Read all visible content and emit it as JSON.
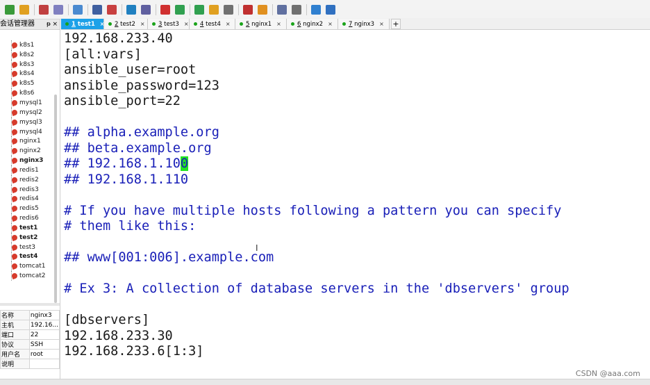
{
  "toolbar": {
    "icons": [
      "new-session-icon",
      "open-folder-icon",
      "connect-icon",
      "disconnect-icon",
      "layout-icon",
      "find-icon",
      "transfer-icon",
      "globe-icon",
      "font-icon",
      "xftp-icon",
      "terminal-icon",
      "fullscreen-icon",
      "lock-icon",
      "keyboard-icon",
      "pen-icon",
      "script-icon",
      "view-icon",
      "settings-icon",
      "help-icon",
      "chat-icon"
    ],
    "colors": [
      "#3a9a3a",
      "#e0a020",
      "#c04040",
      "#8080c0",
      "#4a8ad0",
      "#4060a0",
      "#c84040",
      "#2080c0",
      "#6060a0",
      "#d03030",
      "#30a050",
      "#30a050",
      "#e0a020",
      "#707070",
      "#c03030",
      "#e09020",
      "#6070a0",
      "#707070",
      "#3080d0",
      "#3070c0"
    ]
  },
  "sidebar": {
    "title": "会话管理器",
    "pin": "ᵽ",
    "close": "×",
    "sessions": [
      {
        "label": "k8s1"
      },
      {
        "label": "k8s2"
      },
      {
        "label": "k8s3"
      },
      {
        "label": "k8s4"
      },
      {
        "label": "k8s5"
      },
      {
        "label": "k8s6"
      },
      {
        "label": "mysql1"
      },
      {
        "label": "mysql2"
      },
      {
        "label": "mysql3"
      },
      {
        "label": "mysql4"
      },
      {
        "label": "nginx1"
      },
      {
        "label": "nginx2"
      },
      {
        "label": "nginx3",
        "bold": true
      },
      {
        "label": "redis1"
      },
      {
        "label": "redis2"
      },
      {
        "label": "redis3"
      },
      {
        "label": "redis4"
      },
      {
        "label": "redis5"
      },
      {
        "label": "redis6"
      },
      {
        "label": "test1",
        "bold": true
      },
      {
        "label": "test2",
        "bold": true
      },
      {
        "label": "test3"
      },
      {
        "label": "test4",
        "bold": true
      },
      {
        "label": "tomcat1"
      },
      {
        "label": "tomcat2"
      }
    ]
  },
  "properties": [
    {
      "key": "名称",
      "value": "nginx3"
    },
    {
      "key": "主机",
      "value": "192.16..."
    },
    {
      "key": "端口",
      "value": "22"
    },
    {
      "key": "协议",
      "value": "SSH"
    },
    {
      "key": "用户名",
      "value": "root"
    },
    {
      "key": "说明",
      "value": ""
    }
  ],
  "tabs": [
    {
      "num": "1",
      "name": " test1",
      "active": true
    },
    {
      "num": "2",
      "name": " test2",
      "active": false
    },
    {
      "num": "3",
      "name": " test3",
      "active": false
    },
    {
      "num": "4",
      "name": " test4",
      "active": false
    },
    {
      "num": "5",
      "name": " nginx1",
      "active": false
    },
    {
      "num": "6",
      "name": " nginx2",
      "active": false
    },
    {
      "num": "7",
      "name": " nginx3",
      "active": false
    }
  ],
  "tab_close": "×",
  "add_tab": "+",
  "terminal": {
    "lines": [
      {
        "text": "192.168.233.40",
        "comment": false
      },
      {
        "text": "[all:vars]",
        "comment": false
      },
      {
        "text": "ansible_user=root",
        "comment": false
      },
      {
        "text": "ansible_password=123",
        "comment": false
      },
      {
        "text": "ansible_port=22",
        "comment": false
      },
      {
        "text": "",
        "comment": false
      },
      {
        "text": "## alpha.example.org",
        "comment": true
      },
      {
        "text": "## beta.example.org",
        "comment": true
      },
      {
        "text": "## 192.168.1.10",
        "cursor": "0",
        "comment": true
      },
      {
        "text": "## 192.168.1.110",
        "comment": true
      },
      {
        "text": "",
        "comment": false
      },
      {
        "text": "# If you have multiple hosts following a pattern you can specify",
        "comment": true
      },
      {
        "text": "# them like this:",
        "comment": true
      },
      {
        "text": "",
        "comment": false
      },
      {
        "text": "## www[001:006].example.com",
        "comment": true
      },
      {
        "text": "",
        "comment": false
      },
      {
        "text": "# Ex 3: A collection of database servers in the 'dbservers' group",
        "comment": true
      },
      {
        "text": "",
        "comment": false
      },
      {
        "text": "[dbservers]",
        "comment": false
      },
      {
        "text": "192.168.233.30",
        "comment": false
      },
      {
        "text": "192.168.233.6[1:3]",
        "comment": false
      }
    ],
    "comment_color": "#1a20b8",
    "cursor_color": "#22e322"
  },
  "mouse_cursor": "I",
  "watermark": "CSDN @aaa.com",
  "accent_color": "#1da1e8"
}
